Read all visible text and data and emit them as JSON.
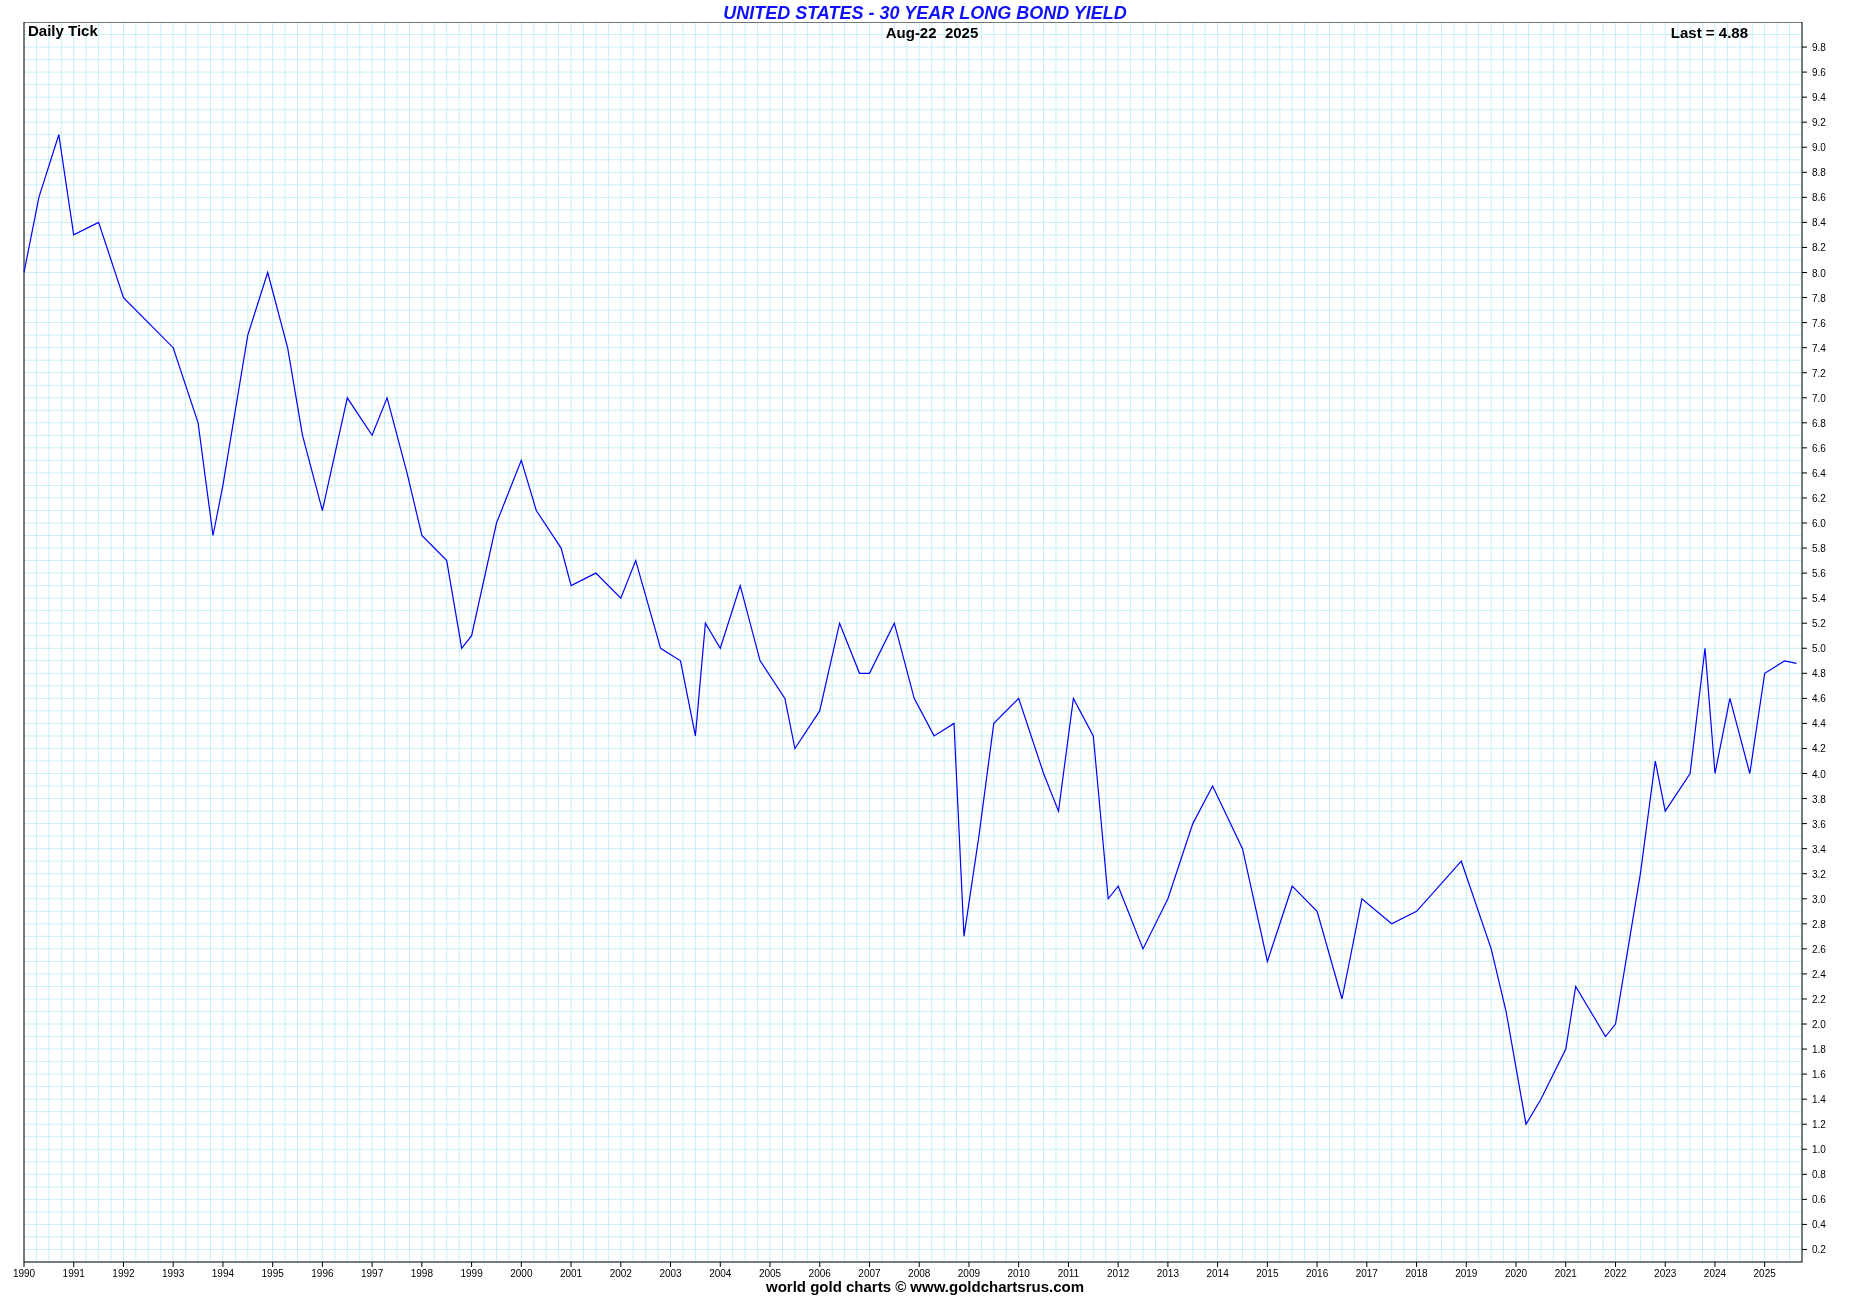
{
  "chart": {
    "subtitle_left": "Daily Tick",
    "date": "Aug-22  2025",
    "last": "Last = 4.88",
    "chart_data": {
      "type": "line",
      "title": "UNITED STATES - 30 YEAR LONG BOND YIELD",
      "grid": true,
      "x": [
        1990.0,
        1990.3,
        1990.7,
        1991.0,
        1991.5,
        1992.0,
        1992.5,
        1993.0,
        1993.5,
        1993.8,
        1994.0,
        1994.5,
        1994.9,
        1995.3,
        1995.6,
        1996.0,
        1996.5,
        1997.0,
        1997.3,
        1997.7,
        1998.0,
        1998.5,
        1998.8,
        1999.0,
        1999.5,
        2000.0,
        2000.3,
        2000.8,
        2001.0,
        2001.5,
        2002.0,
        2002.3,
        2002.8,
        2003.2,
        2003.5,
        2003.7,
        2004.0,
        2004.4,
        2004.8,
        2005.3,
        2005.5,
        2006.0,
        2006.4,
        2006.8,
        2007.0,
        2007.5,
        2007.9,
        2008.3,
        2008.7,
        2008.9,
        2009.2,
        2009.5,
        2010.0,
        2010.5,
        2010.8,
        2011.1,
        2011.5,
        2011.8,
        2012.0,
        2012.5,
        2013.0,
        2013.5,
        2013.9,
        2014.5,
        2015.0,
        2015.5,
        2016.0,
        2016.5,
        2016.9,
        2017.5,
        2018.0,
        2018.9,
        2019.5,
        2019.8,
        2020.2,
        2020.5,
        2021.0,
        2021.2,
        2021.8,
        2022.0,
        2022.5,
        2022.8,
        2023.0,
        2023.5,
        2023.8,
        2024.0,
        2024.3,
        2024.7,
        2025.0,
        2025.4,
        2025.64
      ],
      "series": [
        {
          "color": "#0000ff",
          "values": [
            8.0,
            8.6,
            9.1,
            8.3,
            8.4,
            7.8,
            7.6,
            7.4,
            6.8,
            5.9,
            6.3,
            7.5,
            8.0,
            7.4,
            6.7,
            6.1,
            7.0,
            6.7,
            7.0,
            6.4,
            5.9,
            5.7,
            5.0,
            5.1,
            6.0,
            6.5,
            6.1,
            5.8,
            5.5,
            5.6,
            5.4,
            5.7,
            5.0,
            4.9,
            4.3,
            5.2,
            5.0,
            5.5,
            4.9,
            4.6,
            4.2,
            4.5,
            5.2,
            4.8,
            4.8,
            5.2,
            4.6,
            4.3,
            4.4,
            2.7,
            3.5,
            4.4,
            4.6,
            4.0,
            3.7,
            4.6,
            4.3,
            3.0,
            3.1,
            2.6,
            3.0,
            3.6,
            3.9,
            3.4,
            2.5,
            3.1,
            2.9,
            2.2,
            3.0,
            2.8,
            2.9,
            3.3,
            2.6,
            2.1,
            1.2,
            1.4,
            1.8,
            2.3,
            1.9,
            2.0,
            3.2,
            4.1,
            3.7,
            4.0,
            5.0,
            4.0,
            4.6,
            4.0,
            4.8,
            4.9,
            4.88
          ]
        }
      ],
      "xlim": [
        1990,
        2025.75
      ],
      "ylim": [
        0.1,
        10
      ],
      "xticks": [
        1990,
        1991,
        1992,
        1993,
        1994,
        1995,
        1996,
        1997,
        1998,
        1999,
        2000,
        2001,
        2002,
        2003,
        2004,
        2005,
        2006,
        2007,
        2008,
        2009,
        2010,
        2011,
        2012,
        2013,
        2014,
        2015,
        2016,
        2017,
        2018,
        2019,
        2020,
        2021,
        2022,
        2023,
        2024,
        2025
      ],
      "yticks": [
        0.2,
        0.4,
        0.6,
        0.8,
        {
          "value": 1,
          "label": "1.0"
        },
        1.2,
        1.4,
        1.6,
        1.8,
        {
          "value": 2,
          "label": "2.0"
        },
        2.2,
        2.4,
        2.6,
        2.8,
        {
          "value": 3,
          "label": "3.0"
        },
        3.2,
        3.4,
        3.6,
        3.8,
        {
          "value": 4,
          "label": "4.0"
        },
        4.2,
        4.4,
        4.6,
        4.8,
        {
          "value": 5,
          "label": "5.0"
        },
        5.2,
        5.4,
        5.6,
        5.8,
        {
          "value": 6,
          "label": "6.0"
        },
        6.2,
        6.4,
        6.6,
        6.8,
        {
          "value": 7,
          "label": "7.0"
        },
        7.2,
        7.4,
        7.6,
        7.8,
        {
          "value": 8,
          "label": "8.0"
        },
        8.2,
        8.4,
        8.6,
        8.8,
        {
          "value": 9,
          "label": "9.0"
        },
        9.2,
        9.4,
        9.6,
        9.8
      ]
    }
  },
  "footer": "world gold charts © www.goldchartsrus.com"
}
